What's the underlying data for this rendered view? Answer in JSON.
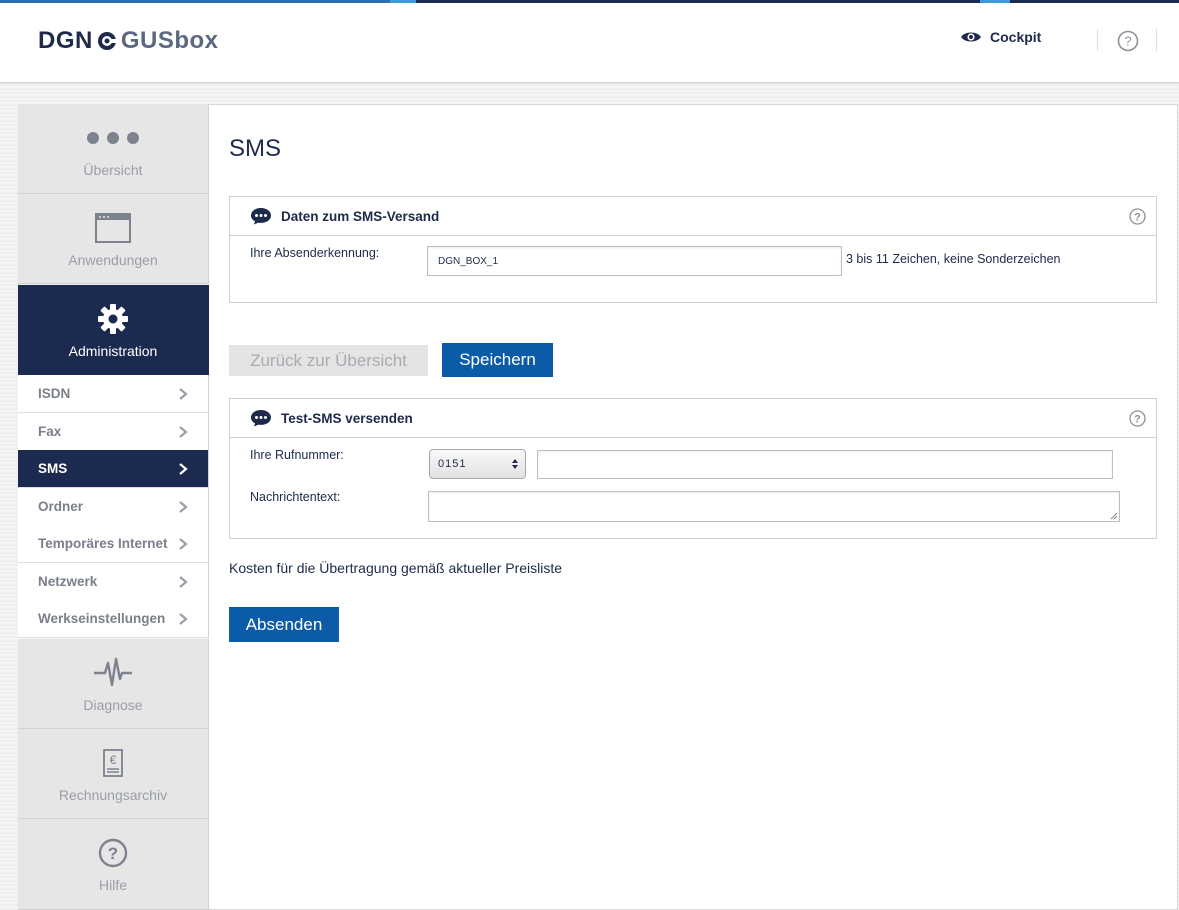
{
  "header": {
    "logo_primary": "DGN",
    "logo_secondary": "GUSbox",
    "cockpit_label": "Cockpit",
    "help_icon": "question-circle-icon"
  },
  "sidebar": {
    "main_items": [
      {
        "label": "Übersicht",
        "icon": "dots-icon",
        "active": false
      },
      {
        "label": "Anwendungen",
        "icon": "window-icon",
        "active": false
      },
      {
        "label": "Administration",
        "icon": "gear-icon",
        "active": true
      },
      {
        "label": "Diagnose",
        "icon": "pulse-icon",
        "active": false
      },
      {
        "label": "Rechnungsarchiv",
        "icon": "invoice-euro-icon",
        "active": false
      },
      {
        "label": "Hilfe",
        "icon": "question-circle-icon",
        "active": false
      }
    ],
    "sub_items": [
      {
        "label": "ISDN",
        "active": false
      },
      {
        "label": "Fax",
        "active": false
      },
      {
        "label": "SMS",
        "active": true
      },
      {
        "label": "Ordner",
        "active": false
      },
      {
        "label": "Temporäres Internet",
        "active": false
      },
      {
        "label": "Netzwerk",
        "active": false
      },
      {
        "label": "Werkseinstellungen",
        "active": false
      }
    ]
  },
  "main": {
    "title": "SMS",
    "sender_panel": {
      "heading": "Daten zum SMS-Versand",
      "sender_label": "Ihre Absenderkennung:",
      "sender_value": "DGN_BOX_1",
      "sender_hint": "3 bis 11 Zeichen, keine Sonderzeichen"
    },
    "buttons": {
      "back_label": "Zurück zur Übersicht",
      "save_label": "Speichern",
      "send_label": "Absenden"
    },
    "test_panel": {
      "heading": "Test-SMS versenden",
      "phone_label": "Ihre Rufnummer:",
      "prefix_selected": "0151",
      "phone_value": "",
      "message_label": "Nachrichtentext:",
      "message_value": ""
    },
    "cost_note": "Kosten für die Übertragung gemäß aktueller Preisliste"
  },
  "colors": {
    "navy": "#1c2a50",
    "primary_button": "#0b5ba8",
    "disabled_button": "#e4e4e4"
  }
}
